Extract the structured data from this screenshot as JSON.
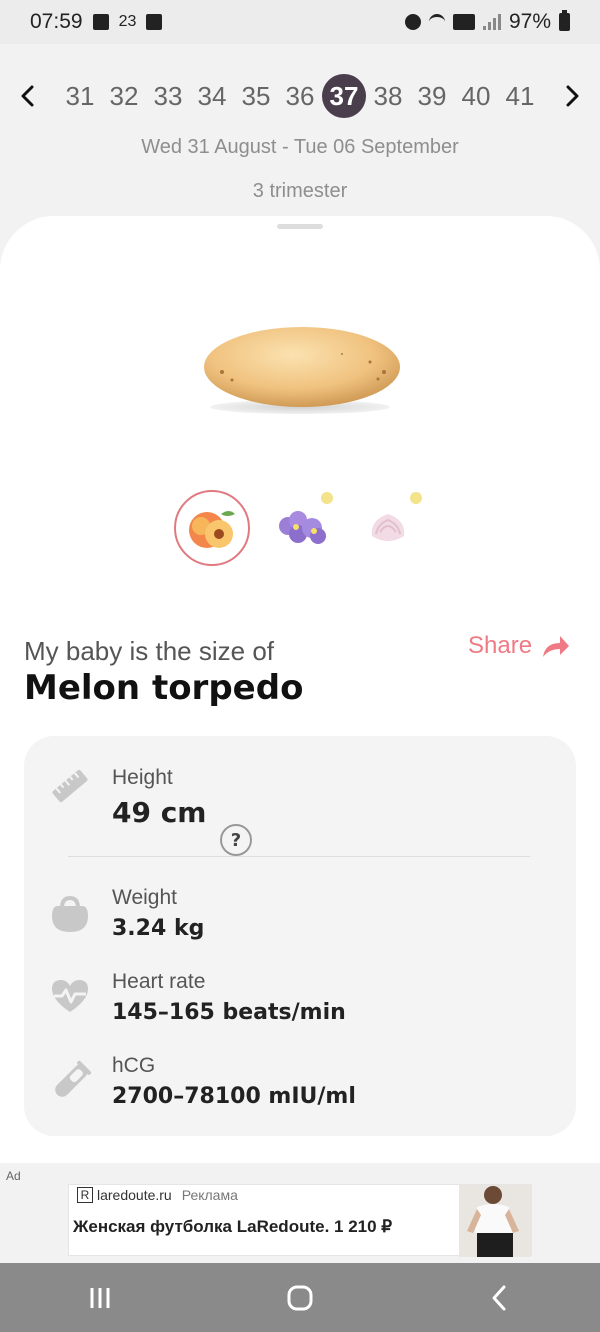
{
  "status_bar": {
    "time": "07:59",
    "temperature": "23",
    "battery": "97%"
  },
  "week_picker": {
    "weeks": [
      "31",
      "32",
      "33",
      "34",
      "35",
      "36",
      "37",
      "38",
      "39",
      "40",
      "41"
    ],
    "selected_week": "37",
    "prev_icon": "chevron-left-icon",
    "next_icon": "chevron-right-icon"
  },
  "period": {
    "dates": "Wed 31 August - Tue 06 September",
    "trimester": "3 trimester"
  },
  "size": {
    "label": "My baby is the size of",
    "name": "Melon torpedo",
    "share_label": "Share"
  },
  "thumbnails": [
    {
      "name": "peach-icon",
      "active": true
    },
    {
      "name": "violet-flower-icon",
      "active": false
    },
    {
      "name": "marshmallow-icon",
      "active": false
    }
  ],
  "stats": {
    "height": {
      "label": "Height",
      "value": "49 cm",
      "help": "?"
    },
    "weight": {
      "label": "Weight",
      "value": "3.24 kg"
    },
    "heart_rate": {
      "label": "Heart rate",
      "value": "145–165 beats/min"
    },
    "hcg": {
      "label": "hCG",
      "value": "2700–78100 mIU/ml"
    }
  },
  "ad": {
    "tag": "Ad",
    "marker": "R",
    "domain": "laredoute.ru",
    "reklama": "Реклама",
    "title": "Женская футболка LaRedoute. 1 210 ₽"
  },
  "colors": {
    "accent": "#f07a84",
    "selected_week_bg": "#4a3d4c"
  }
}
